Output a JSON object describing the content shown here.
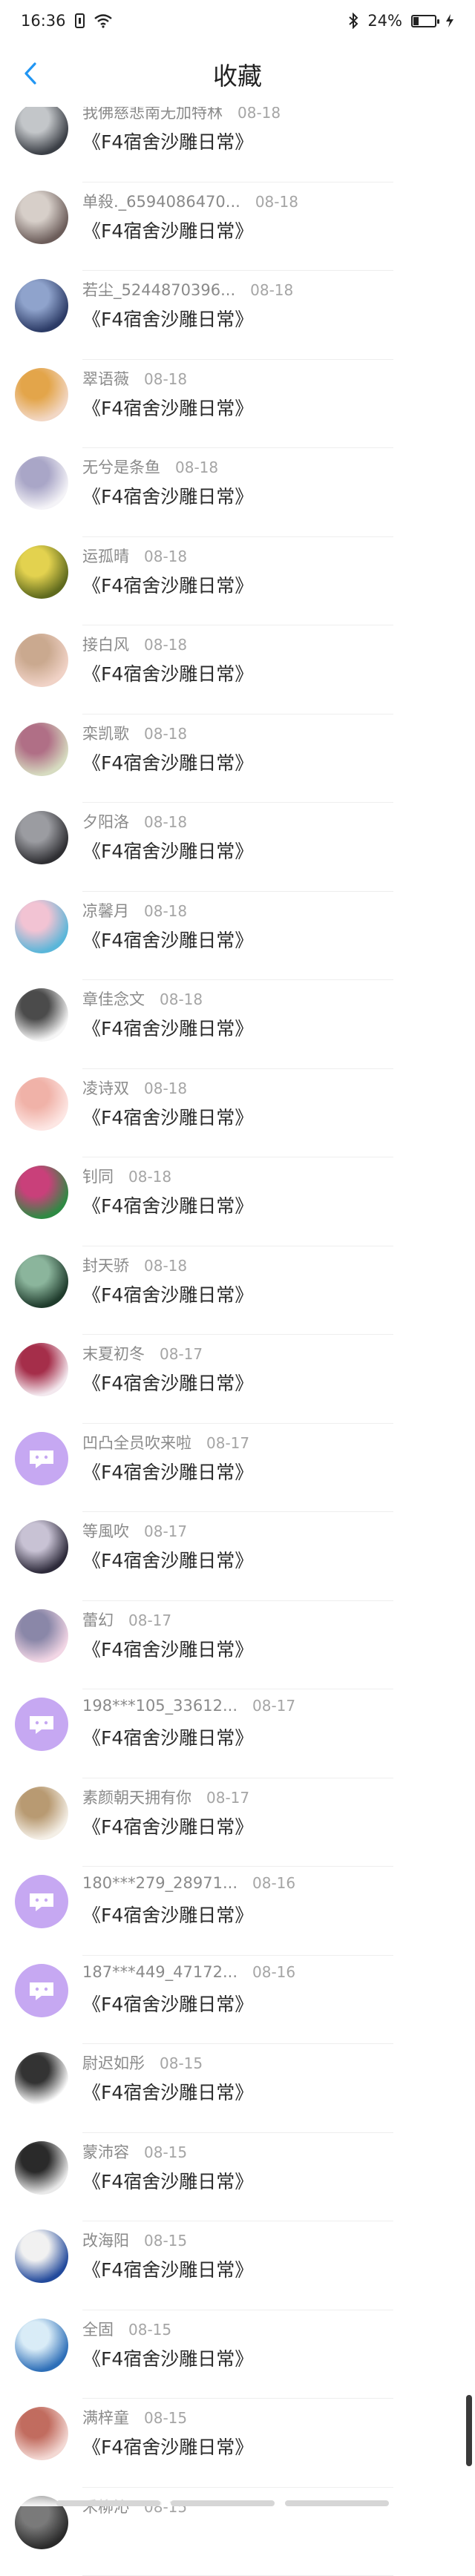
{
  "status_bar": {
    "time": "16:36",
    "battery_percent": "24%",
    "battery_level": 0.24
  },
  "header": {
    "title": "收藏"
  },
  "colors": {
    "accent": "#2196f3",
    "default_avatar_bg": "#c6a8f2"
  },
  "items": [
    {
      "name": "我佛慈悲南无加特林",
      "date": "08-18",
      "content": "《F4宿舍沙雕日常》",
      "avatar": "photo-avatar",
      "palette": [
        "#3b3f46",
        "#c3c6c9"
      ]
    },
    {
      "name": "单殺._6594086470...",
      "date": "08-18",
      "content": "《F4宿舍沙雕日常》",
      "avatar": "photo-avatar",
      "palette": [
        "#6c5d5a",
        "#d7cfc9"
      ]
    },
    {
      "name": "若尘_5244870396...",
      "date": "08-18",
      "content": "《F4宿舍沙雕日常》",
      "avatar": "photo-avatar",
      "palette": [
        "#2c3b66",
        "#8fa3cc"
      ]
    },
    {
      "name": "翠语薇",
      "date": "08-18",
      "content": "《F4宿舍沙雕日常》",
      "avatar": "photo-avatar",
      "palette": [
        "#f2d7c4",
        "#e3a54a"
      ]
    },
    {
      "name": "无兮是条鱼",
      "date": "08-18",
      "content": "《F4宿舍沙雕日常》",
      "avatar": "photo-avatar",
      "palette": [
        "#f4f3f7",
        "#a9a6c7"
      ]
    },
    {
      "name": "运孤晴",
      "date": "08-18",
      "content": "《F4宿舍沙雕日常》",
      "avatar": "photo-avatar",
      "palette": [
        "#5f6a1d",
        "#e3d24f"
      ]
    },
    {
      "name": "接白风",
      "date": "08-18",
      "content": "《F4宿舍沙雕日常》",
      "avatar": "photo-avatar",
      "palette": [
        "#f0d2c6",
        "#caa98f"
      ]
    },
    {
      "name": "栾凯歌",
      "date": "08-18",
      "content": "《F4宿舍沙雕日常》",
      "avatar": "photo-avatar",
      "palette": [
        "#d6dbc0",
        "#b06f86"
      ]
    },
    {
      "name": "夕阳洛",
      "date": "08-18",
      "content": "《F4宿舍沙雕日常》",
      "avatar": "photo-avatar",
      "palette": [
        "#2f2f33",
        "#9b9ca1"
      ]
    },
    {
      "name": "凉馨月",
      "date": "08-18",
      "content": "《F4宿舍沙雕日常》",
      "avatar": "photo-avatar",
      "palette": [
        "#5ab6d9",
        "#f2c3d3"
      ]
    },
    {
      "name": "章佳念文",
      "date": "08-18",
      "content": "《F4宿舍沙雕日常》",
      "avatar": "photo-avatar",
      "palette": [
        "#f5f5f5",
        "#4b4b4b"
      ]
    },
    {
      "name": "凌诗双",
      "date": "08-18",
      "content": "《F4宿舍沙雕日常》",
      "avatar": "photo-avatar",
      "palette": [
        "#fde6e3",
        "#f0b2a8"
      ]
    },
    {
      "name": "钊同",
      "date": "08-18",
      "content": "《F4宿舍沙雕日常》",
      "avatar": "photo-avatar",
      "palette": [
        "#2e8a43",
        "#c9407a"
      ]
    },
    {
      "name": "封天骄",
      "date": "08-18",
      "content": "《F4宿舍沙雕日常》",
      "avatar": "photo-avatar",
      "palette": [
        "#1f3b2c",
        "#8bb59c"
      ]
    },
    {
      "name": "末夏初冬",
      "date": "08-17",
      "content": "《F4宿舍沙雕日常》",
      "avatar": "photo-avatar",
      "palette": [
        "#f3e8ee",
        "#a52e4a"
      ]
    },
    {
      "name": "凹凸全员吹来啦",
      "date": "08-17",
      "content": "《F4宿舍沙雕日常》",
      "avatar": "default-avatar",
      "palette": [
        "#c6a8f2",
        "#ffffff"
      ]
    },
    {
      "name": "等風吹",
      "date": "08-17",
      "content": "《F4宿舍沙雕日常》",
      "avatar": "photo-avatar",
      "palette": [
        "#2d2a3a",
        "#c8c2d4"
      ]
    },
    {
      "name": "蕾幻",
      "date": "08-17",
      "content": "《F4宿舍沙雕日常》",
      "avatar": "photo-avatar",
      "palette": [
        "#f2d6e5",
        "#8a87a8"
      ]
    },
    {
      "name": "198***105_33612...",
      "date": "08-17",
      "content": "《F4宿舍沙雕日常》",
      "avatar": "default-avatar",
      "palette": [
        "#c6a8f2",
        "#ffffff"
      ]
    },
    {
      "name": "素颜朝天拥有你",
      "date": "08-17",
      "content": "《F4宿舍沙雕日常》",
      "avatar": "photo-avatar",
      "palette": [
        "#f4efe6",
        "#b89a72"
      ]
    },
    {
      "name": "180***279_28971...",
      "date": "08-16",
      "content": "《F4宿舍沙雕日常》",
      "avatar": "default-avatar",
      "palette": [
        "#c6a8f2",
        "#ffffff"
      ]
    },
    {
      "name": "187***449_47172...",
      "date": "08-16",
      "content": "《F4宿舍沙雕日常》",
      "avatar": "default-avatar",
      "palette": [
        "#c6a8f2",
        "#ffffff"
      ]
    },
    {
      "name": "尉迟如彤",
      "date": "08-15",
      "content": "《F4宿舍沙雕日常》",
      "avatar": "photo-avatar",
      "palette": [
        "#ffffff",
        "#333333"
      ]
    },
    {
      "name": "蒙沛容",
      "date": "08-15",
      "content": "《F4宿舍沙雕日常》",
      "avatar": "photo-avatar",
      "palette": [
        "#e9e9e9",
        "#2a2a2a"
      ]
    },
    {
      "name": "改海阳",
      "date": "08-15",
      "content": "《F4宿舍沙雕日常》",
      "avatar": "photo-avatar",
      "palette": [
        "#234a9c",
        "#f1f1f1"
      ]
    },
    {
      "name": "全固",
      "date": "08-15",
      "content": "《F4宿舍沙雕日常》",
      "avatar": "photo-avatar",
      "palette": [
        "#2e6fb8",
        "#d9ecf7"
      ]
    },
    {
      "name": "满梓童",
      "date": "08-15",
      "content": "《F4宿舍沙雕日常》",
      "avatar": "photo-avatar",
      "palette": [
        "#f3d8d3",
        "#c16c5f"
      ]
    },
    {
      "name": "禾柳沁",
      "date": "08-15",
      "content": "",
      "avatar": "photo-avatar",
      "palette": [
        "#2a2a2a",
        "#7a7a7a"
      ]
    }
  ]
}
